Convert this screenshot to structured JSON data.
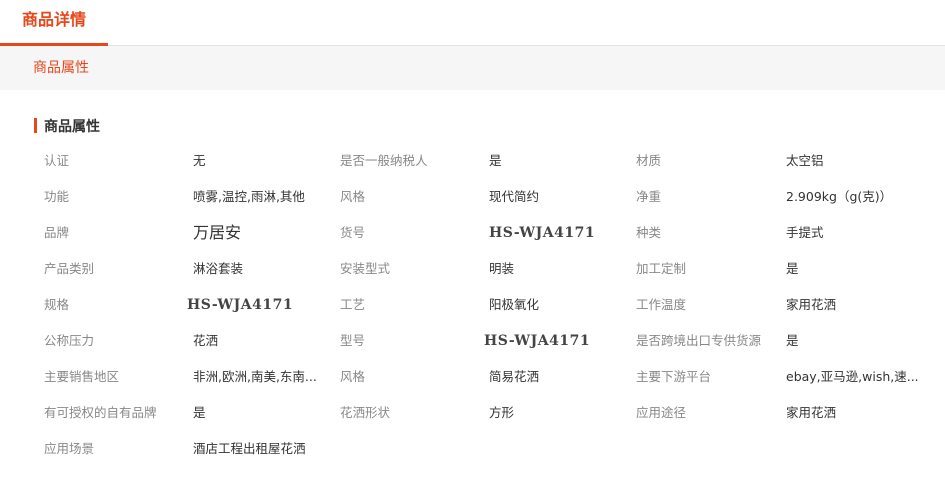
{
  "tabs": {
    "active_label": "商品详情"
  },
  "subtab": {
    "label": "商品属性"
  },
  "section": {
    "title": "商品属性"
  },
  "colors": {
    "accent": "#e8471c",
    "label": "#888888",
    "value": "#333333",
    "subbar_bg": "#f6f6f6"
  },
  "rows": [
    [
      {
        "label": "认证",
        "value": "无"
      },
      {
        "label": "是否一般纳税人",
        "value": "是"
      },
      {
        "label": "材质",
        "value": "太空铝"
      }
    ],
    [
      {
        "label": "功能",
        "value": "喷雾,温控,雨淋,其他"
      },
      {
        "label": "风格",
        "value": "现代简约"
      },
      {
        "label": "净重",
        "value": "2.909kg（g(克)）"
      }
    ],
    [
      {
        "label": "品牌",
        "value": "万居安"
      },
      {
        "label": "货号",
        "value": "HS-WJA4171"
      },
      {
        "label": "种类",
        "value": "手提式"
      }
    ],
    [
      {
        "label": "产品类别",
        "value": "淋浴套装"
      },
      {
        "label": "安装型式",
        "value": "明装"
      },
      {
        "label": "加工定制",
        "value": "是"
      }
    ],
    [
      {
        "label": "规格",
        "value": "HS-WJA4171"
      },
      {
        "label": "工艺",
        "value": "阳极氧化"
      },
      {
        "label": "工作温度",
        "value": "家用花洒"
      }
    ],
    [
      {
        "label": "公称压力",
        "value": "花洒"
      },
      {
        "label": "型号",
        "value": "HS-WJA4171"
      },
      {
        "label": "是否跨境出口专供货源",
        "value": "是"
      }
    ],
    [
      {
        "label": "主要销售地区",
        "value": "非洲,欧洲,南美,东南..."
      },
      {
        "label": "风格",
        "value": "简易花洒"
      },
      {
        "label": "主要下游平台",
        "value": "ebay,亚马逊,wish,速..."
      }
    ],
    [
      {
        "label": "有可授权的自有品牌",
        "value": "是"
      },
      {
        "label": "花洒形状",
        "value": "方形"
      },
      {
        "label": "应用途径",
        "value": "家用花洒"
      }
    ],
    [
      {
        "label": "应用场景",
        "value": "酒店工程出租屋花洒"
      }
    ]
  ]
}
